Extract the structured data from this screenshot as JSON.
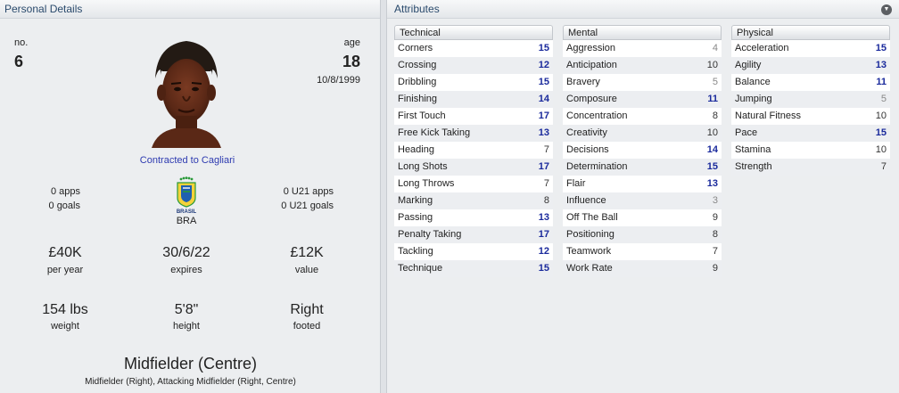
{
  "personal": {
    "title": "Personal Details",
    "no_label": "no.",
    "no_value": "6",
    "age_label": "age",
    "age_value": "18",
    "dob": "10/8/1999",
    "contract": "Contracted to Cagliari",
    "apps": "0 apps",
    "goals": "0 goals",
    "nation": "BRA",
    "crest_text": "BRASIL",
    "u21_apps": "0 U21 apps",
    "u21_goals": "0 U21 goals",
    "wage_value": "£40K",
    "wage_label": "per year",
    "expires_value": "30/6/22",
    "expires_label": "expires",
    "value_value": "£12K",
    "value_label": "value",
    "weight_value": "154 lbs",
    "weight_label": "weight",
    "height_value": "5'8\"",
    "height_label": "height",
    "foot_value": "Right",
    "foot_label": "footed",
    "position_main": "Midfielder (Centre)",
    "position_sub": "Midfielder (Right), Attacking Midfielder (Right, Centre)"
  },
  "attributes": {
    "title": "Attributes",
    "collapse_icon": "chevron-down-icon",
    "technical": {
      "heading": "Technical",
      "items": [
        {
          "name": "Corners",
          "value": "15"
        },
        {
          "name": "Crossing",
          "value": "12"
        },
        {
          "name": "Dribbling",
          "value": "15"
        },
        {
          "name": "Finishing",
          "value": "14"
        },
        {
          "name": "First Touch",
          "value": "17"
        },
        {
          "name": "Free Kick Taking",
          "value": "13"
        },
        {
          "name": "Heading",
          "value": "7"
        },
        {
          "name": "Long Shots",
          "value": "17"
        },
        {
          "name": "Long Throws",
          "value": "7"
        },
        {
          "name": "Marking",
          "value": "8"
        },
        {
          "name": "Passing",
          "value": "13"
        },
        {
          "name": "Penalty Taking",
          "value": "17"
        },
        {
          "name": "Tackling",
          "value": "12"
        },
        {
          "name": "Technique",
          "value": "15"
        }
      ]
    },
    "mental": {
      "heading": "Mental",
      "items": [
        {
          "name": "Aggression",
          "value": "4"
        },
        {
          "name": "Anticipation",
          "value": "10"
        },
        {
          "name": "Bravery",
          "value": "5"
        },
        {
          "name": "Composure",
          "value": "11"
        },
        {
          "name": "Concentration",
          "value": "8"
        },
        {
          "name": "Creativity",
          "value": "10"
        },
        {
          "name": "Decisions",
          "value": "14"
        },
        {
          "name": "Determination",
          "value": "15"
        },
        {
          "name": "Flair",
          "value": "13"
        },
        {
          "name": "Influence",
          "value": "3"
        },
        {
          "name": "Off The Ball",
          "value": "9"
        },
        {
          "name": "Positioning",
          "value": "8"
        },
        {
          "name": "Teamwork",
          "value": "7"
        },
        {
          "name": "Work Rate",
          "value": "9"
        }
      ]
    },
    "physical": {
      "heading": "Physical",
      "items": [
        {
          "name": "Acceleration",
          "value": "15"
        },
        {
          "name": "Agility",
          "value": "13"
        },
        {
          "name": "Balance",
          "value": "11"
        },
        {
          "name": "Jumping",
          "value": "5"
        },
        {
          "name": "Natural Fitness",
          "value": "10"
        },
        {
          "name": "Pace",
          "value": "15"
        },
        {
          "name": "Stamina",
          "value": "10"
        },
        {
          "name": "Strength",
          "value": "7"
        }
      ]
    }
  }
}
